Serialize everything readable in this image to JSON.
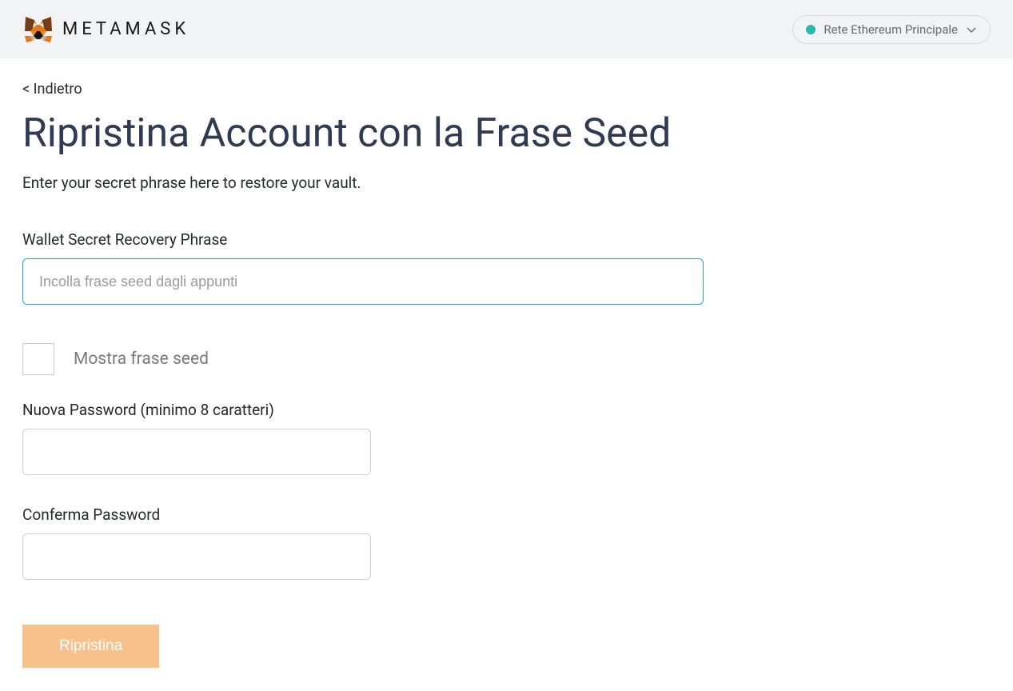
{
  "header": {
    "brand": "METAMASK",
    "network": "Rete Ethereum Principale"
  },
  "nav": {
    "back": "< Indietro"
  },
  "page": {
    "title": "Ripristina Account con la Frase Seed",
    "subtitle": "Enter your secret phrase here to restore your vault."
  },
  "form": {
    "seed_label": "Wallet Secret Recovery Phrase",
    "seed_placeholder": "Incolla frase seed dagli appunti",
    "show_seed_label": "Mostra frase seed",
    "new_password_label": "Nuova Password (minimo 8 caratteri)",
    "confirm_password_label": "Conferma Password",
    "restore_button": "Ripristina"
  }
}
